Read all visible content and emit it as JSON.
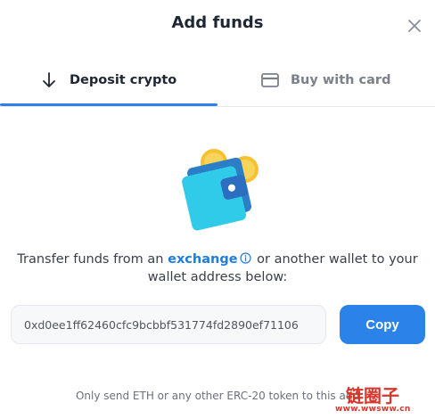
{
  "dialog": {
    "title": "Add funds",
    "close_icon": "close-icon"
  },
  "tabs": [
    {
      "label": "Deposit crypto",
      "icon": "arrow-down-icon",
      "active": true
    },
    {
      "label": "Buy with card",
      "icon": "credit-card-icon",
      "active": false
    }
  ],
  "illustration": {
    "icon": "wallet-coins-icon"
  },
  "description": {
    "before": "Transfer funds from an ",
    "link": "exchange",
    "after_line1": " or another wallet to your",
    "line2": "wallet address below:"
  },
  "address": {
    "value": "0xd0ee1ff62460cfc9bcbbf531774fd2890ef71106"
  },
  "copy_button": {
    "label": "Copy"
  },
  "note": {
    "text": "Only send ETH or any other ERC-20 token to this add"
  },
  "watermark": {
    "line1": "链圈子",
    "line2": "www.wwsww.cn"
  },
  "colors": {
    "accent": "#2b83ea",
    "link": "#1f7ce0",
    "tab_indicator": "#2f80ed",
    "watermark": "#d9352b"
  }
}
